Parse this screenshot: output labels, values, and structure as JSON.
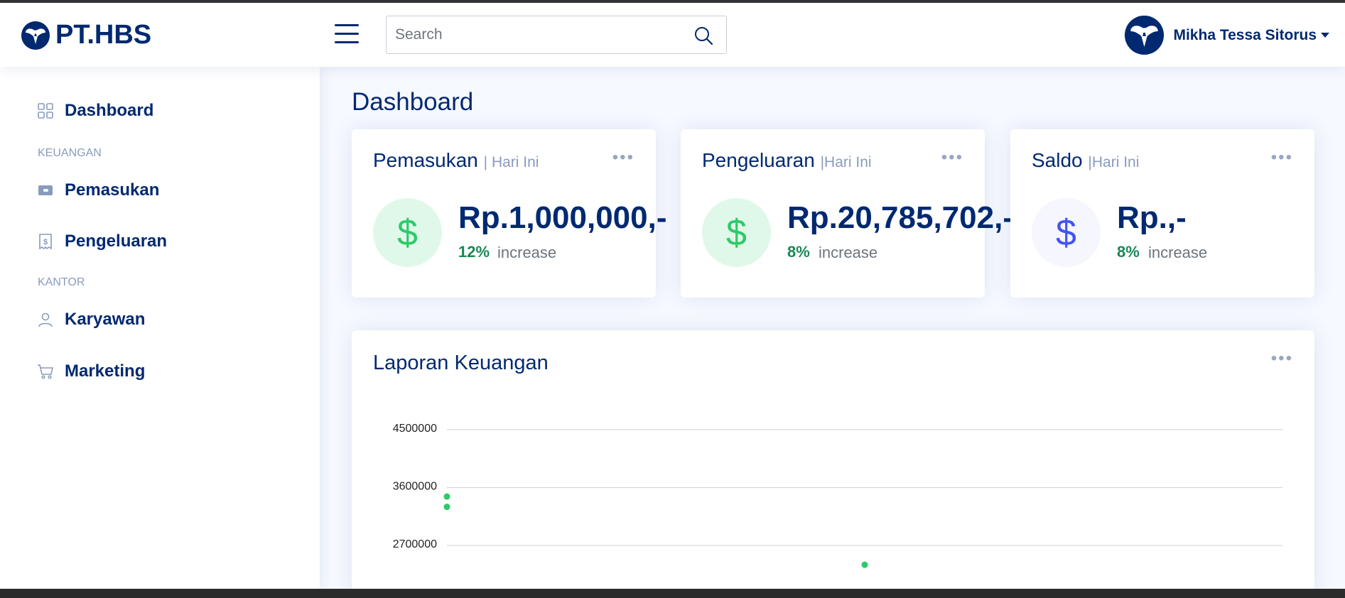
{
  "brand": {
    "name": "PT.HBS"
  },
  "search": {
    "placeholder": "Search"
  },
  "user": {
    "name": "Mikha Tessa Sitorus"
  },
  "sidebar": {
    "items": [
      {
        "label": "Dashboard",
        "icon": "grid-icon"
      },
      {
        "label": "Pemasukan",
        "icon": "wallet-icon"
      },
      {
        "label": "Pengeluaran",
        "icon": "receipt-icon"
      },
      {
        "label": "Karyawan",
        "icon": "person-icon"
      },
      {
        "label": "Marketing",
        "icon": "cart-icon"
      }
    ],
    "headings": {
      "keuangan": "KEUANGAN",
      "kantor": "KANTOR"
    }
  },
  "page": {
    "title": "Dashboard"
  },
  "cards": [
    {
      "title": "Pemasukan",
      "period": "| Hari Ini",
      "amount": "Rp.1,000,000,-",
      "percent": "12%",
      "trend": "increase",
      "icon": "$",
      "color": "#2eca6a",
      "bg": "#e0f8e9"
    },
    {
      "title": "Pengeluaran",
      "period": "|Hari Ini",
      "amount": "Rp.20,785,702,-",
      "percent": "8%",
      "trend": "increase",
      "icon": "$",
      "color": "#2eca6a",
      "bg": "#e0f8e9"
    },
    {
      "title": "Saldo",
      "period": "|Hari Ini",
      "amount": "Rp.,-",
      "percent": "8%",
      "trend": "increase",
      "icon": "$",
      "color": "#4154f1",
      "bg": "#f6f6fe"
    }
  ],
  "report": {
    "title": "Laporan Keuangan"
  },
  "chart_data": {
    "type": "scatter",
    "title": "",
    "xlabel": "",
    "ylabel": "",
    "ylim": [
      2400000,
      4500000
    ],
    "y_ticks": [
      "4500000",
      "3600000",
      "2700000"
    ],
    "series": [
      {
        "color": "#2eca6a",
        "points": [
          {
            "x": 0,
            "y": 3460000
          },
          {
            "x": 0,
            "y": 3300000
          },
          {
            "x": 0.5,
            "y": 2400000
          }
        ]
      }
    ],
    "grid": true
  }
}
